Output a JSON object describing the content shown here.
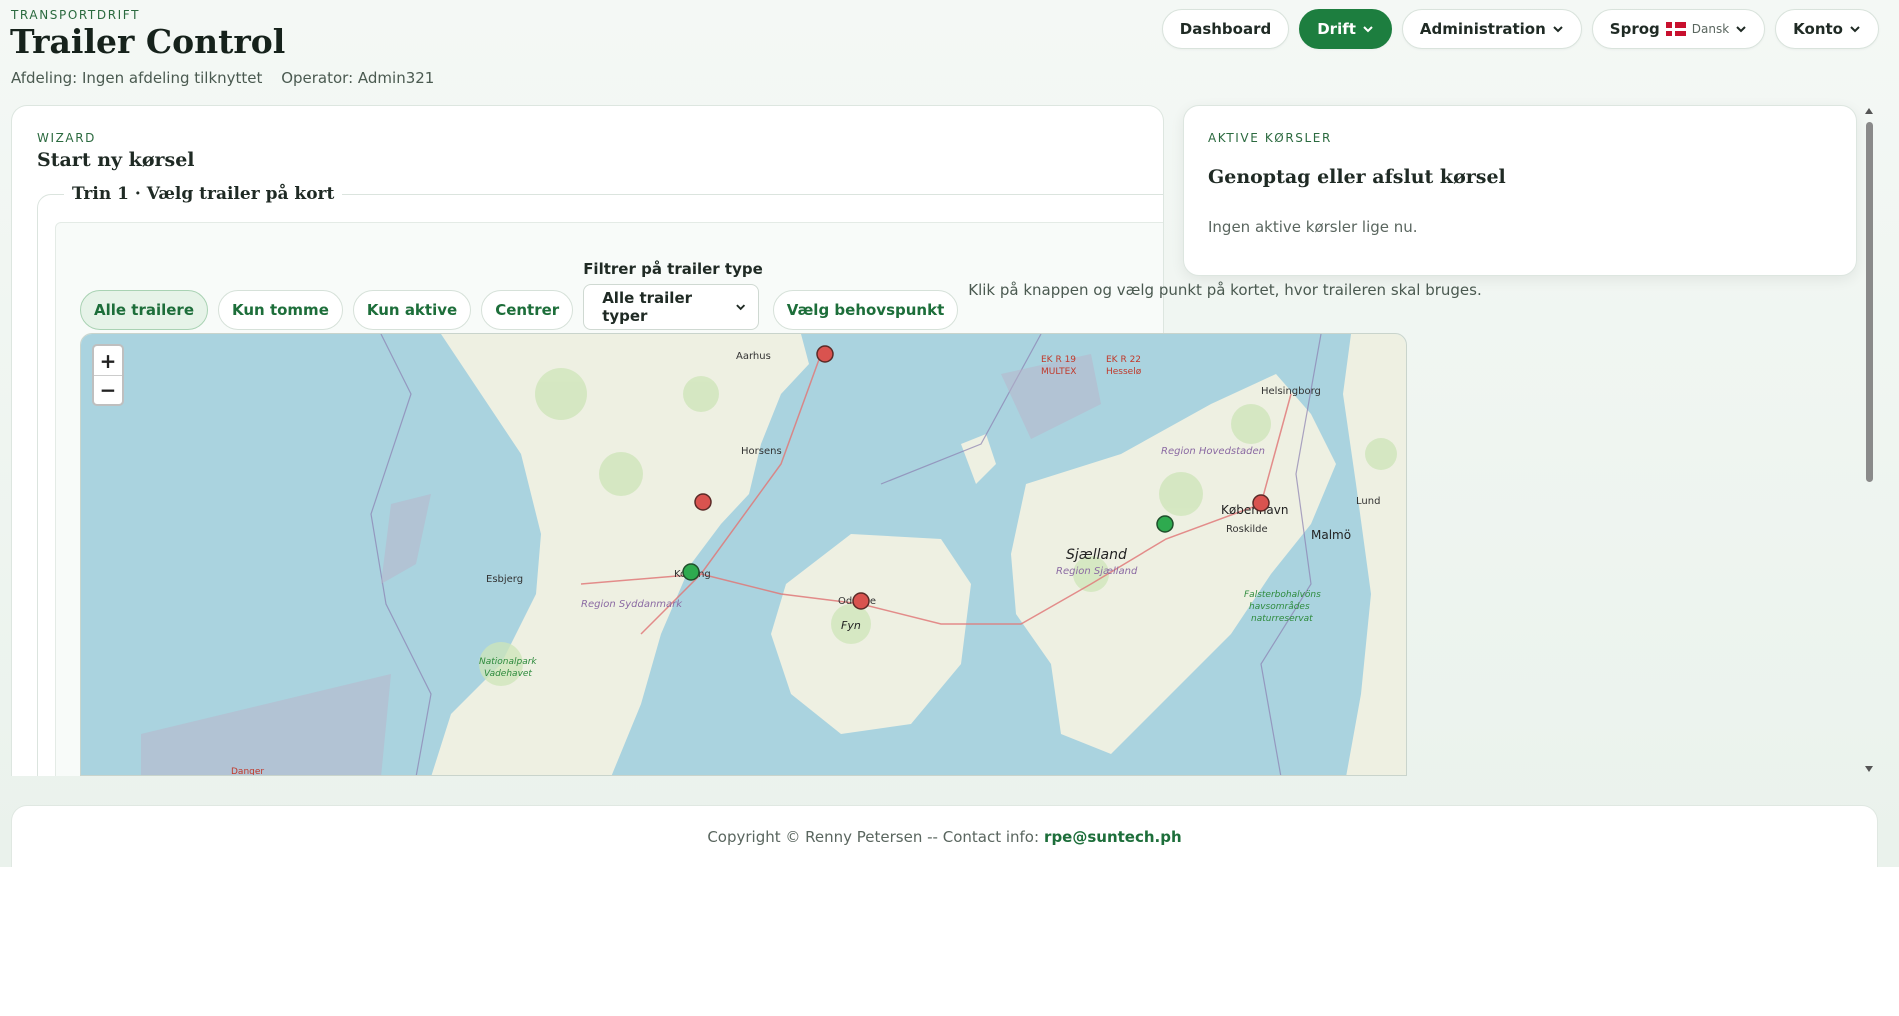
{
  "header": {
    "eyebrow": "TRANSPORTDRIFT",
    "title": "Trailer Control",
    "department": "Afdeling: Ingen afdeling tilknyttet",
    "operator": "Operator: Admin321"
  },
  "nav": {
    "dashboard": "Dashboard",
    "drift": "Drift",
    "administration": "Administration",
    "language": "Sprog",
    "language_value": "Dansk",
    "account": "Konto"
  },
  "wizard": {
    "eyebrow": "WIZARD",
    "title": "Start ny kørsel",
    "step_legend": "Trin 1 · Vælg trailer på kort",
    "filters": [
      "Alle trailere",
      "Kun tomme",
      "Kun aktive",
      "Centrer"
    ],
    "type_filter_label": "Filtrer på trailer type",
    "type_filter_value": "Alle trailer typer",
    "need_point_button": "Vælg behovspunkt",
    "hint": "Klik på knappen og vælg punkt på kortet, hvor traileren skal bruges."
  },
  "map": {
    "zoom_in": "+",
    "zoom_out": "−",
    "labels": {
      "aarhus": "Aarhus",
      "horsens": "Horsens",
      "esbjerg": "Esbjerg",
      "kolding": "Kolding",
      "odense": "Odense",
      "fyn": "Fyn",
      "region_syd": "Region Syddanmark",
      "nationalpark_1": "Nationalpark",
      "nationalpark_2": "Vadehavet",
      "sjaelland": "Sjælland",
      "region_sjaelland": "Region Sjælland",
      "region_hovedstaden": "Region Hovedstaden",
      "roskilde": "Roskilde",
      "kobenhavn": "København",
      "helsingborg": "Helsingborg",
      "lund": "Lund",
      "malmo": "Malmö",
      "ekr19_1": "EK R 19",
      "ekr19_2": "MULTEX",
      "ekr22_1": "EK R 22",
      "ekr22_2": "Hesselø",
      "reservat_1": "Falsterbohalvöns",
      "reservat_2": "havsområdes",
      "reservat_3": "naturreservat",
      "danger": "Danger"
    },
    "marker_colors": {
      "red": "#d9534f",
      "green": "#2eaa4f"
    }
  },
  "active_trips": {
    "eyebrow": "AKTIVE KØRSLER",
    "title": "Genoptag eller afslut kørsel",
    "empty": "Ingen aktive kørsler lige nu."
  },
  "footer": {
    "text": "Copyright © Renny Petersen -- Contact info:",
    "email": "rpe@suntech.ph"
  },
  "colors": {
    "accent": "#1d7e3f",
    "sea": "#aad3df",
    "land": "#eef0e2"
  }
}
